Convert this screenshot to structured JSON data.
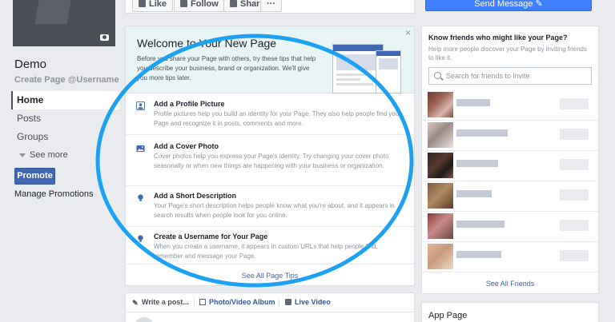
{
  "page": {
    "name": "Demo",
    "username_link": "Create Page @Username"
  },
  "nav": {
    "items": [
      {
        "label": "Home"
      },
      {
        "label": "Posts"
      },
      {
        "label": "Groups"
      }
    ],
    "see_more": "See more"
  },
  "promote": {
    "button": "Promote",
    "manage": "Manage Promotions"
  },
  "actions": {
    "like": "Like",
    "follow": "Follow",
    "share": "Share",
    "more": "···",
    "send_message": "Send Message"
  },
  "welcome": {
    "title": "Welcome to Your New Page",
    "description": "Before you share your Page with others, try these tips that help you describe your business, brand or organization. We'll give you more tips later.",
    "close": "×",
    "tips": [
      {
        "title": "Add a Profile Picture",
        "desc": "Profile pictures help you build an identity for your Page. They also help people find your Page and recognize it in posts, comments and more.",
        "icon": "profile-picture-icon"
      },
      {
        "title": "Add a Cover Photo",
        "desc": "Cover photos help you express your Page's identity. Try changing your cover photo seasonally or when new things are happening with your business or organization.",
        "icon": "cover-photo-icon"
      },
      {
        "title": "Add a Short Description",
        "desc": "Your Page's short description helps people know what you're about, and it appears in search results when people look for you online.",
        "icon": "lightbulb-icon"
      },
      {
        "title": "Create a Username for Your Page",
        "desc": "When you create a username, it appears in custom URLs that help people find, remember and message your Page.",
        "icon": "lightbulb-icon"
      }
    ],
    "see_all": "See All Page Tips"
  },
  "composer": {
    "write_post": "Write a post...",
    "photo_video": "Photo/Video Album",
    "live_video": "Live Video"
  },
  "friends": {
    "title": "Know friends who might like your Page?",
    "desc": "Help more people discover your Page by inviting friends to like it.",
    "search_placeholder": "Search for friends to invite",
    "see_all": "See All Friends"
  },
  "app_page": {
    "title": "App Page"
  },
  "colors": {
    "brand_blue": "#4267b2",
    "send_blue": "#4080ff",
    "annotation_ring": "#1da1f2"
  }
}
